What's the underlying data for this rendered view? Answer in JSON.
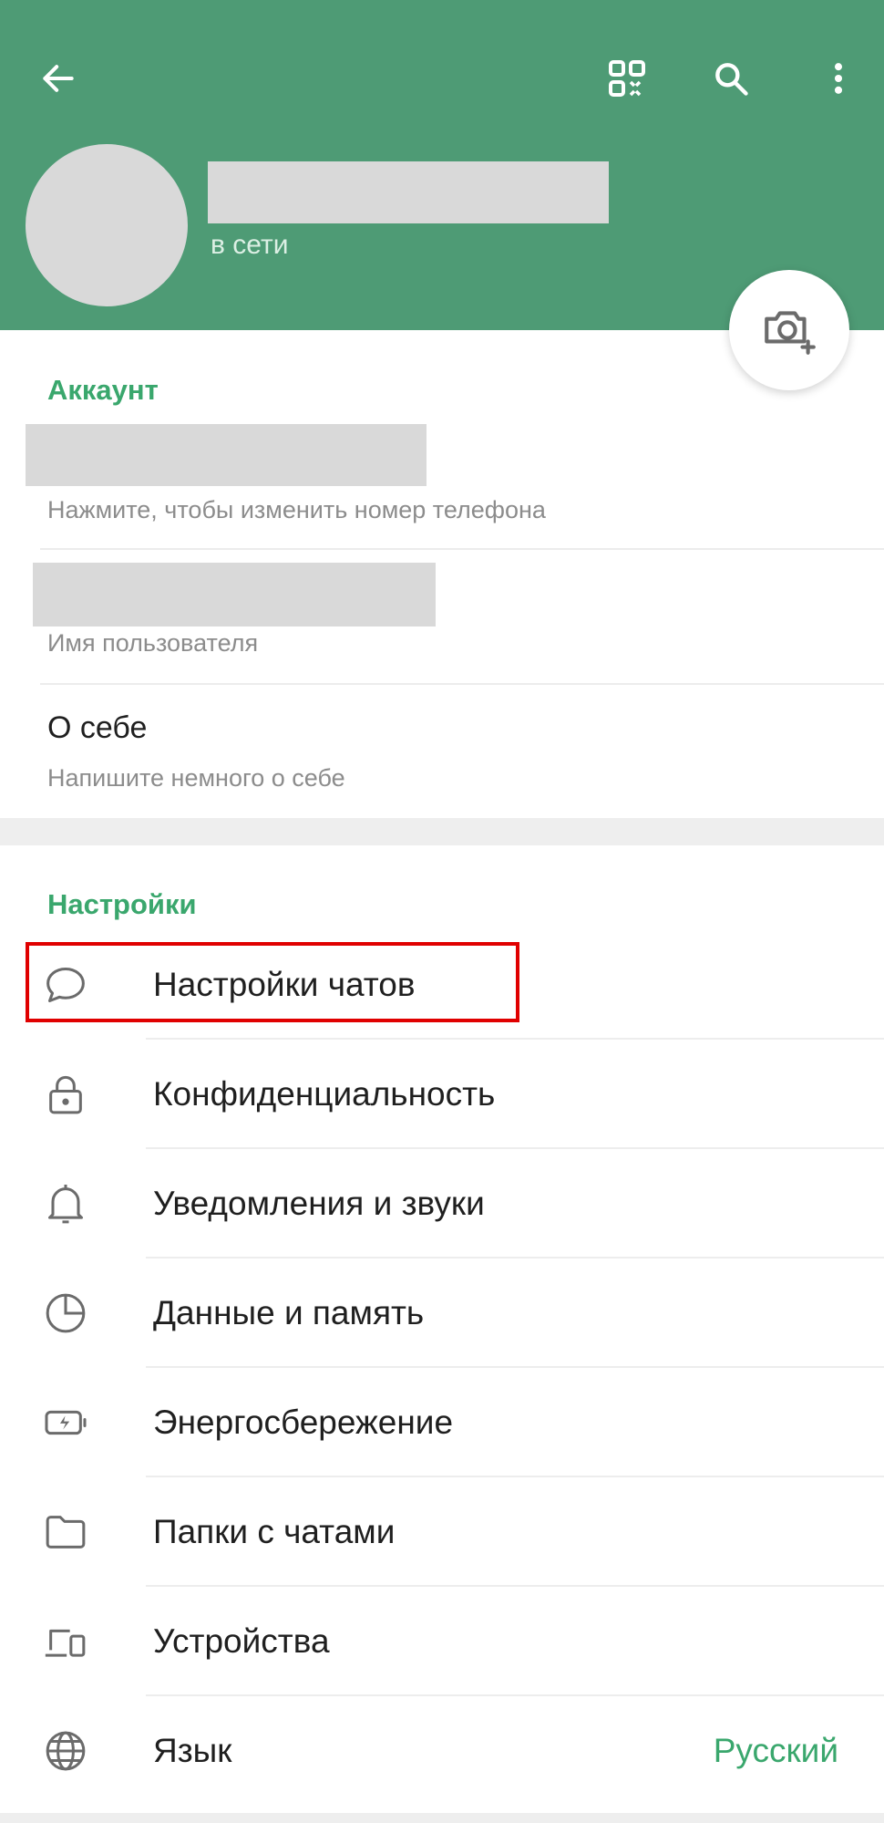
{
  "colors": {
    "header": "#4e9b75",
    "accent": "#3aa76d",
    "highlight": "#e00000"
  },
  "header": {
    "back_icon": "arrow-left-icon",
    "qr_icon": "qr-code-icon",
    "search_icon": "search-icon",
    "menu_icon": "more-vertical-icon",
    "status": "в сети",
    "camera_icon": "camera-add-icon"
  },
  "account": {
    "title": "Аккаунт",
    "phone_hint": "Нажмите, чтобы изменить номер телефона",
    "username_hint": "Имя пользователя",
    "bio_label": "О себе",
    "bio_hint": "Напишите немного о себе"
  },
  "settings": {
    "title": "Настройки",
    "items": [
      {
        "icon": "chat-bubble-icon",
        "label": "Настройки чатов"
      },
      {
        "icon": "lock-icon",
        "label": "Конфиденциальность"
      },
      {
        "icon": "bell-icon",
        "label": "Уведомления и звуки"
      },
      {
        "icon": "pie-clock-icon",
        "label": "Данные и память"
      },
      {
        "icon": "battery-icon",
        "label": "Энергосбережение"
      },
      {
        "icon": "folder-icon",
        "label": "Папки с чатами"
      },
      {
        "icon": "devices-icon",
        "label": "Устройства"
      },
      {
        "icon": "globe-icon",
        "label": "Язык",
        "value": "Русский"
      }
    ]
  }
}
